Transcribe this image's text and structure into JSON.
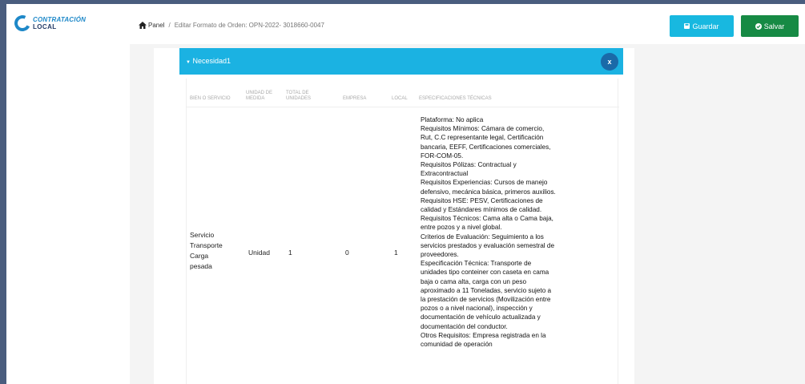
{
  "logo": {
    "line1": "CONTRATACIÓN",
    "line2": "LOCAL"
  },
  "breadcrumb": {
    "home": "Panel",
    "sep": "/",
    "current": "Editar Formato de Orden: OPN-2022- 3018660-0047"
  },
  "buttons": {
    "guardar": "Guardar",
    "salvar": "Salvar"
  },
  "panel": {
    "title": "Necesidad1",
    "close": "x"
  },
  "table": {
    "headers": {
      "bien": "BIEN O SERVICIO",
      "unidad_1": "UNIDAD DE",
      "unidad_2": "MEDIDA",
      "total_1": "TOTAL DE",
      "total_2": "UNIDADES",
      "empresa": "EMPRESA",
      "local": "LOCAL",
      "especificaciones": "ESPECIFICACIONES TÉCNICAS"
    },
    "row": {
      "bien_lines": [
        "Servicio",
        "Transporte",
        "Carga",
        "pesada"
      ],
      "unidad": "Unidad",
      "total": "1",
      "empresa": "0",
      "local": "1",
      "spec_lines": [
        "Plataforma: No aplica",
        "Requisitos Mínimos: Cámara de comercio,",
        "Rut, C.C representante legal, Certificación",
        "bancaria, EEFF, Certificaciones comerciales,",
        "FOR-COM-05.",
        "Requisitos Pólizas: Contractual y",
        "Extracontractual",
        "Requisitos Experiencias: Cursos de manejo",
        "defensivo, mecánica básica, primeros auxilios.",
        "Requisitos HSE: PESV, Certificaciones de",
        "calidad y Estándares mínimos de calidad.",
        "Requisitos Técnicos: Cama alta o Cama baja,",
        "entre pozos y a nivel global.",
        "Criterios de Evaluación: Seguimiento a los",
        "servicios prestados y evaluación semestral de",
        "proveedores.",
        "Especificación Técnica: Transporte de",
        "unidades tipo conteiner con caseta en cama",
        "baja o cama alta, carga con un peso",
        "aproximado a 11 Toneladas, servicio sujeto a",
        "la prestación de servicios (Movilización entre",
        "pozos o a nivel nacional), inspección y",
        "documentación de vehículo actualizada y",
        "documentación del conductor.",
        "Otros Requisitos: Empresa registrada en la",
        "comunidad de operación"
      ]
    }
  },
  "colors": {
    "accent": "#1bb2e2",
    "save": "#168a44",
    "close_btn": "#1a6aa8"
  }
}
